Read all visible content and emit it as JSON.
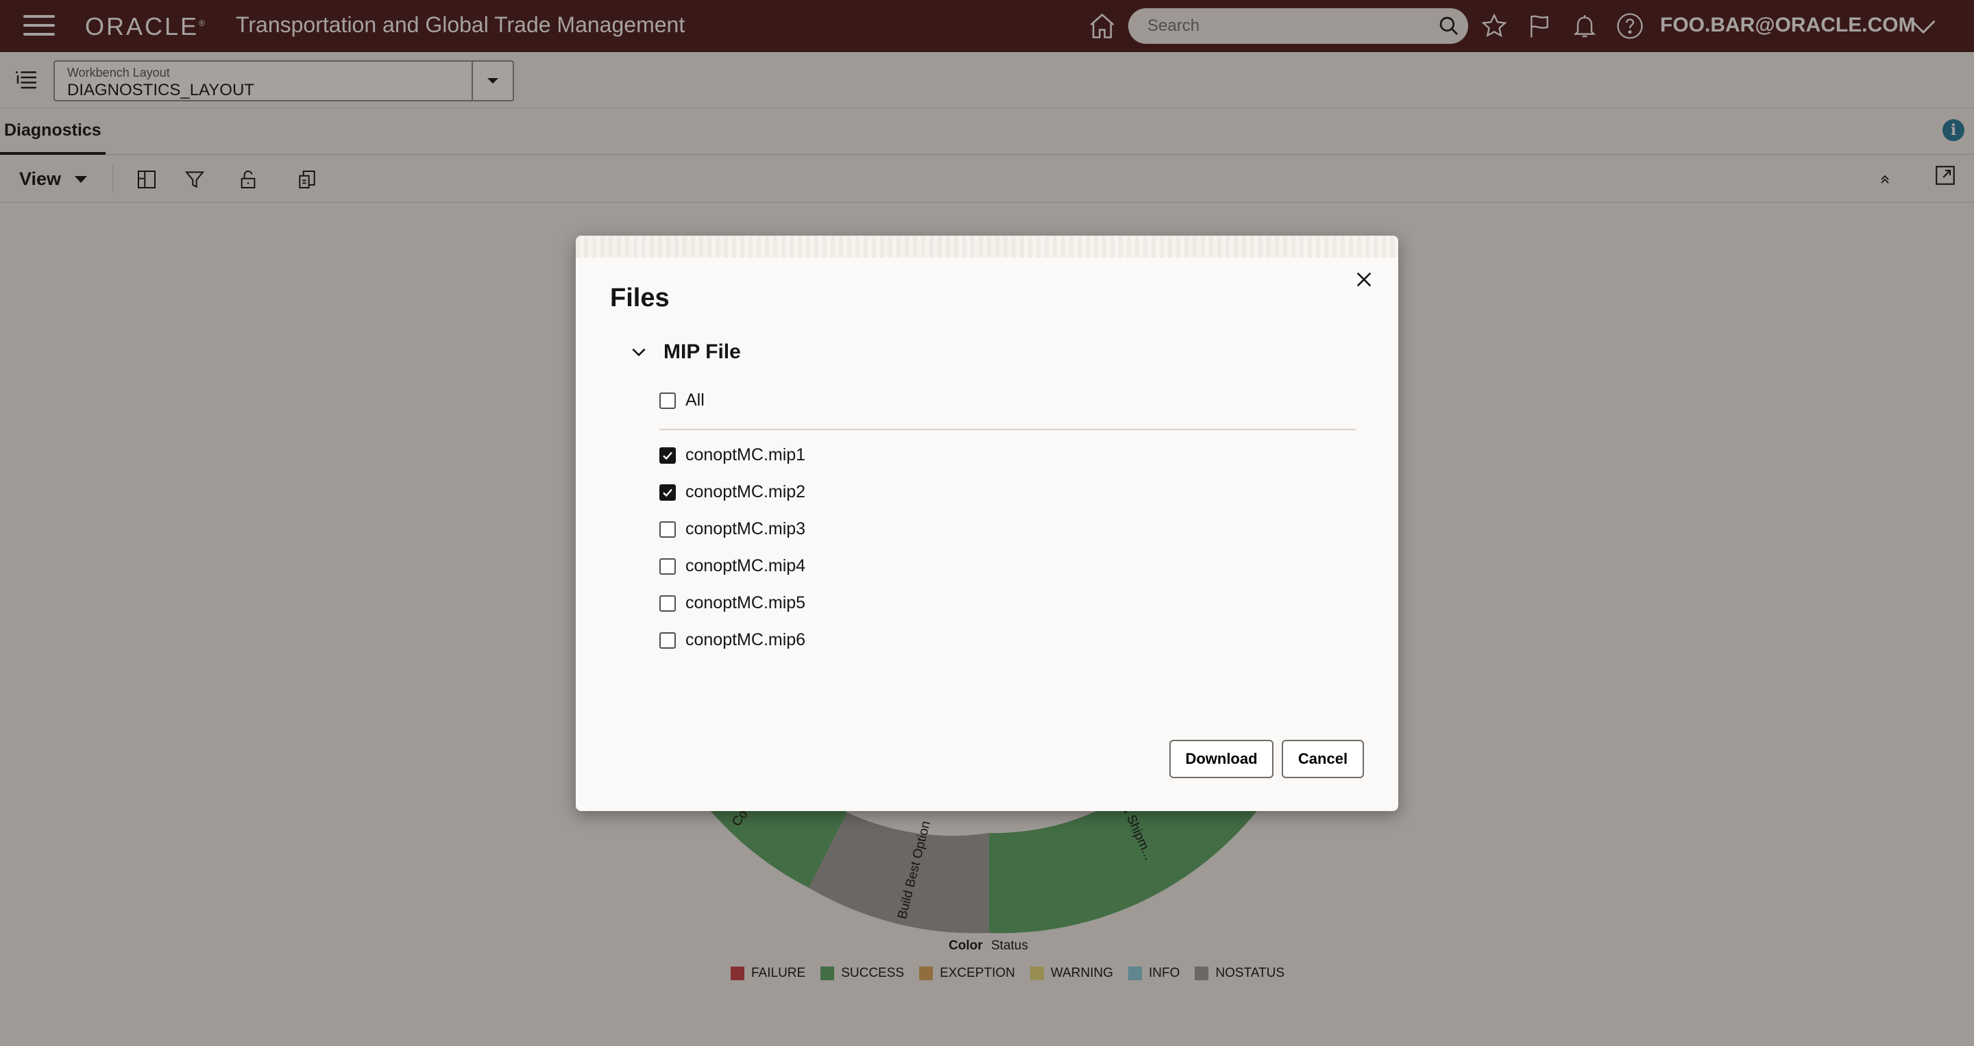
{
  "header": {
    "brand": "ORACLE",
    "app_title": "Transportation and Global Trade Management",
    "search_placeholder": "Search",
    "user": "FOO.BAR@ORACLE.COM"
  },
  "workbench": {
    "label": "Workbench Layout",
    "value": "DIAGNOSTICS_LAYOUT"
  },
  "tabs": [
    {
      "label": "Diagnostics"
    }
  ],
  "toolbar": {
    "view_label": "View"
  },
  "icons": {
    "menu": "hamburger-icon",
    "home": "home-icon",
    "search": "search-icon",
    "favorites": "star-icon",
    "flag": "flag-icon",
    "notifications": "bell-icon",
    "help": "help-icon",
    "user_menu": "chevron-down-icon",
    "info": "info-icon",
    "layout": "layout-icon",
    "filter": "filter-icon",
    "unlock": "unlock-icon",
    "export": "export-icon",
    "collapse": "collapse-up-icon",
    "pop_out": "pop-out-icon"
  },
  "chart": {
    "segment_labels": [
      "Co",
      "Build Best Option",
      "ect Shipm..."
    ],
    "legend_title": "Color",
    "legend_value": "Status",
    "legend": [
      {
        "label": "FAILURE",
        "color": "#c9424a"
      },
      {
        "label": "SUCCESS",
        "color": "#5aa96a"
      },
      {
        "label": "EXCEPTION",
        "color": "#e0a85e"
      },
      {
        "label": "WARNING",
        "color": "#e8dc7d"
      },
      {
        "label": "INFO",
        "color": "#8dd2e4"
      },
      {
        "label": "NOSTATUS",
        "color": "#9e9e9e"
      }
    ]
  },
  "dialog": {
    "title": "Files",
    "section": "MIP File",
    "all_label": "All",
    "all_checked": false,
    "files": [
      {
        "name": "conoptMC.mip1",
        "checked": true
      },
      {
        "name": "conoptMC.mip2",
        "checked": true
      },
      {
        "name": "conoptMC.mip3",
        "checked": false
      },
      {
        "name": "conoptMC.mip4",
        "checked": false
      },
      {
        "name": "conoptMC.mip5",
        "checked": false
      },
      {
        "name": "conoptMC.mip6",
        "checked": false
      }
    ],
    "download_label": "Download",
    "cancel_label": "Cancel"
  }
}
